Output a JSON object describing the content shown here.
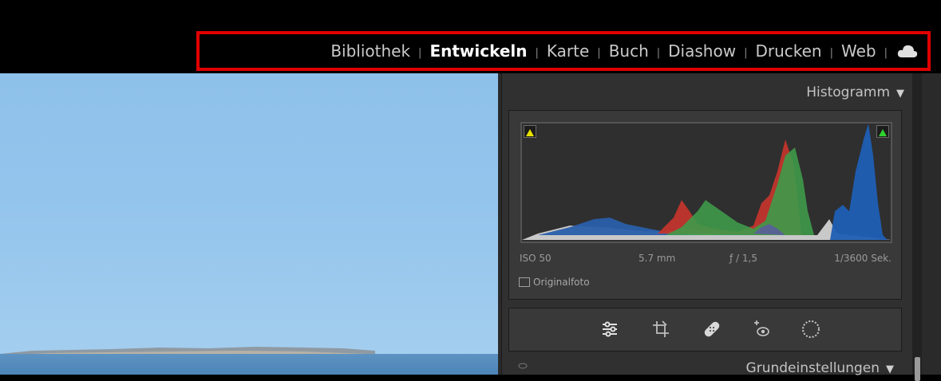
{
  "app": {
    "module_nav": [
      "Bibliothek",
      "Entwickeln",
      "Karte",
      "Buch",
      "Diashow",
      "Drucken",
      "Web"
    ],
    "active_module": "Entwickeln",
    "cloud_icon": "cloud-icon",
    "highlight_color": "#e00000"
  },
  "modules": {
    "bibliothek": "Bibliothek",
    "entwickeln": "Entwickeln",
    "karte": "Karte",
    "buch": "Buch",
    "diashow": "Diashow",
    "drucken": "Drucken",
    "web": "Web",
    "separator": "|"
  },
  "histogram": {
    "header": "Histogramm",
    "collapse_glyph": "▼",
    "iso": "ISO 50",
    "focal_length": "5.7 mm",
    "aperture": "ƒ / 1,5",
    "shutter": "1/3600 Sek.",
    "original_label": "Originalfoto",
    "shadow_clip_color": "#e8e000",
    "highlight_clip_color": "#2fd12f"
  },
  "tools": [
    "sliders-icon",
    "crop-icon",
    "healing-icon",
    "redeye-icon",
    "radial-mask-icon"
  ],
  "grundeinstellungen": {
    "header": "Grundeinstellungen",
    "collapse_glyph": "▼"
  }
}
